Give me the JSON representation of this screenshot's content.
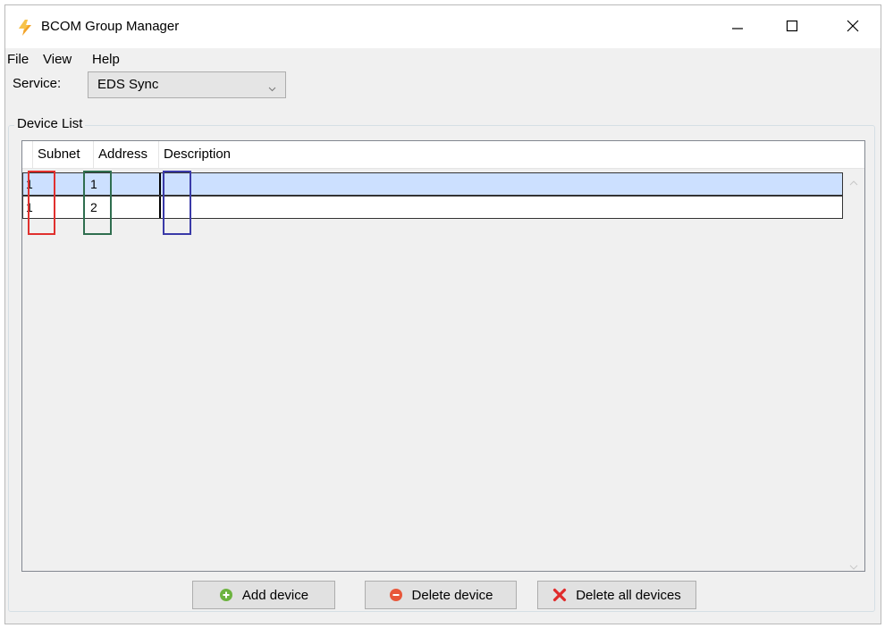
{
  "window": {
    "title": "BCOM Group Manager",
    "app_icon": "lightning-bolt-icon"
  },
  "title_controls": {
    "minimize_icon": "minimize-icon",
    "maximize_icon": "maximize-icon",
    "close_icon": "close-icon"
  },
  "menu": {
    "items": [
      {
        "label": "File"
      },
      {
        "label": "View"
      },
      {
        "label": "Help"
      }
    ]
  },
  "service": {
    "label": "Service:",
    "selected": "EDS Sync",
    "icon": "chevron-down-icon"
  },
  "device_list": {
    "title": "Device List",
    "columns": [
      {
        "label": "Subnet"
      },
      {
        "label": "Address"
      },
      {
        "label": "Description"
      }
    ],
    "rows": [
      {
        "subnet": "1",
        "address": "1",
        "description": "",
        "selected": true
      },
      {
        "subnet": "1",
        "address": "2",
        "description": "",
        "selected": false
      }
    ]
  },
  "highlights": {
    "subnet_color": "#e0302e",
    "address_color": "#2f6e4f",
    "description_color": "#3a3aa8"
  },
  "buttons": {
    "add": {
      "label": "Add device",
      "icon": "plus-circle-icon",
      "color": "#6cb33f"
    },
    "delete": {
      "label": "Delete device",
      "icon": "minus-circle-icon",
      "color": "#e8573a"
    },
    "delete_all": {
      "label": "Delete all devices",
      "icon": "red-x-icon",
      "color": "#e02b2b"
    }
  },
  "colors": {
    "selected_row": "#cce0ff",
    "window_bg": "#f0f0f0"
  }
}
